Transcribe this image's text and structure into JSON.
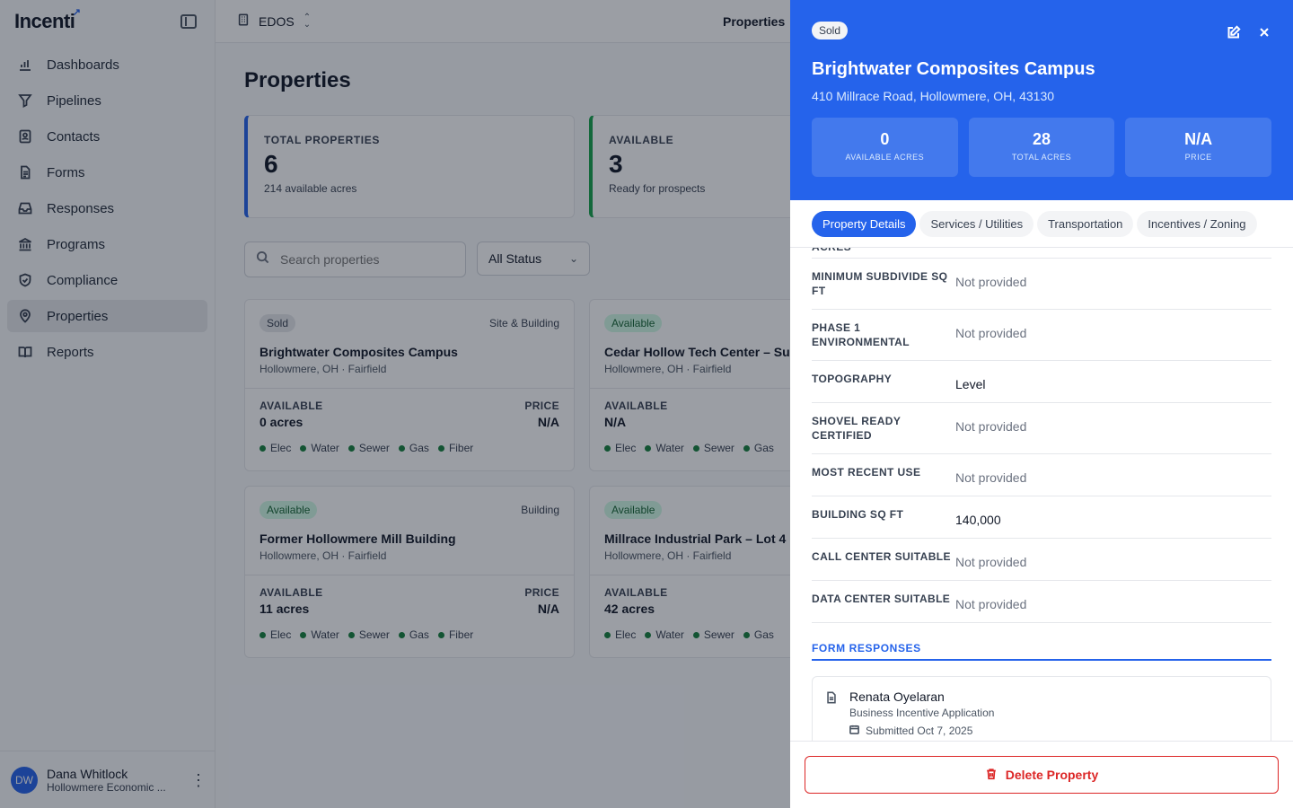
{
  "app": {
    "brand": "Incenti",
    "org": "EDOS",
    "top_title": "Properties"
  },
  "sidebar": {
    "items": [
      {
        "label": "Dashboards",
        "icon": "bar-chart-icon"
      },
      {
        "label": "Pipelines",
        "icon": "filter-icon"
      },
      {
        "label": "Contacts",
        "icon": "contact-card-icon"
      },
      {
        "label": "Forms",
        "icon": "document-icon"
      },
      {
        "label": "Responses",
        "icon": "inbox-icon"
      },
      {
        "label": "Programs",
        "icon": "landmark-icon"
      },
      {
        "label": "Compliance",
        "icon": "shield-check-icon"
      },
      {
        "label": "Properties",
        "icon": "map-pin-icon",
        "active": true
      },
      {
        "label": "Reports",
        "icon": "book-icon"
      }
    ],
    "user": {
      "initials": "DW",
      "name": "Dana Whitlock",
      "org": "Hollowmere Economic ..."
    }
  },
  "main": {
    "title": "Properties",
    "stats": [
      {
        "label": "TOTAL PROPERTIES",
        "value": "6",
        "sub": "214 available acres",
        "accent": "#2563eb"
      },
      {
        "label": "AVAILABLE",
        "value": "3",
        "sub": "Ready for prospects",
        "accent": "#16a34a"
      }
    ],
    "search_placeholder": "Search properties",
    "status_filter": "All Status",
    "cards": [
      {
        "status": "Sold",
        "type": "Site & Building",
        "name": "Brightwater Composites Campus",
        "location": "Hollowmere, OH · Fairfield",
        "available_label": "AVAILABLE",
        "available": "0 acres",
        "price_label": "PRICE",
        "price": "N/A",
        "utilities": [
          "Elec",
          "Water",
          "Sewer",
          "Gas",
          "Fiber"
        ]
      },
      {
        "status": "Available",
        "type": "",
        "name": "Cedar Hollow Tech Center – Su",
        "location": "Hollowmere, OH · Fairfield",
        "available_label": "AVAILABLE",
        "available": "N/A",
        "price_label": "",
        "price": "",
        "utilities": [
          "Elec",
          "Water",
          "Sewer",
          "Gas"
        ]
      },
      {
        "status": "Available",
        "type": "Building",
        "name": "Former Hollowmere Mill Building",
        "location": "Hollowmere, OH · Fairfield",
        "available_label": "AVAILABLE",
        "available": "11 acres",
        "price_label": "PRICE",
        "price": "N/A",
        "utilities": [
          "Elec",
          "Water",
          "Sewer",
          "Gas",
          "Fiber"
        ]
      },
      {
        "status": "Available",
        "type": "",
        "name": "Millrace Industrial Park – Lot 4",
        "location": "Hollowmere, OH · Fairfield",
        "available_label": "AVAILABLE",
        "available": "42 acres",
        "price_label": "",
        "price": "",
        "utilities": [
          "Elec",
          "Water",
          "Sewer",
          "Gas"
        ]
      }
    ]
  },
  "drawer": {
    "status": "Sold",
    "title": "Brightwater Composites Campus",
    "address": "410 Millrace Road, Hollowmere, OH, 43130",
    "metrics": [
      {
        "value": "0",
        "label": "AVAILABLE ACRES"
      },
      {
        "value": "28",
        "label": "TOTAL ACRES"
      },
      {
        "value": "N/A",
        "label": "PRICE"
      }
    ],
    "tabs": [
      {
        "label": "Property Details",
        "active": true
      },
      {
        "label": "Services / Utilities"
      },
      {
        "label": "Transportation"
      },
      {
        "label": "Incentives / Zoning"
      }
    ],
    "cut_label": "ACRES",
    "details": [
      {
        "label": "MINIMUM SUBDIVIDE SQ FT",
        "value": "Not provided",
        "muted": true
      },
      {
        "label": "PHASE 1 ENVIRONMENTAL",
        "value": "Not provided",
        "muted": true
      },
      {
        "label": "TOPOGRAPHY",
        "value": "Level",
        "muted": false
      },
      {
        "label": "SHOVEL READY CERTIFIED",
        "value": "Not provided",
        "muted": true
      },
      {
        "label": "MOST RECENT USE",
        "value": "Not provided",
        "muted": true
      },
      {
        "label": "BUILDING SQ FT",
        "value": "140,000",
        "muted": false
      },
      {
        "label": "CALL CENTER SUITABLE",
        "value": "Not provided",
        "muted": true
      },
      {
        "label": "DATA CENTER SUITABLE",
        "value": "Not provided",
        "muted": true
      }
    ],
    "form_responses_title": "FORM RESPONSES",
    "response": {
      "name": "Renata Oyelaran",
      "form": "Business Incentive Application",
      "submitted": "Submitted Oct 7, 2025"
    },
    "delete_label": "Delete Property"
  }
}
